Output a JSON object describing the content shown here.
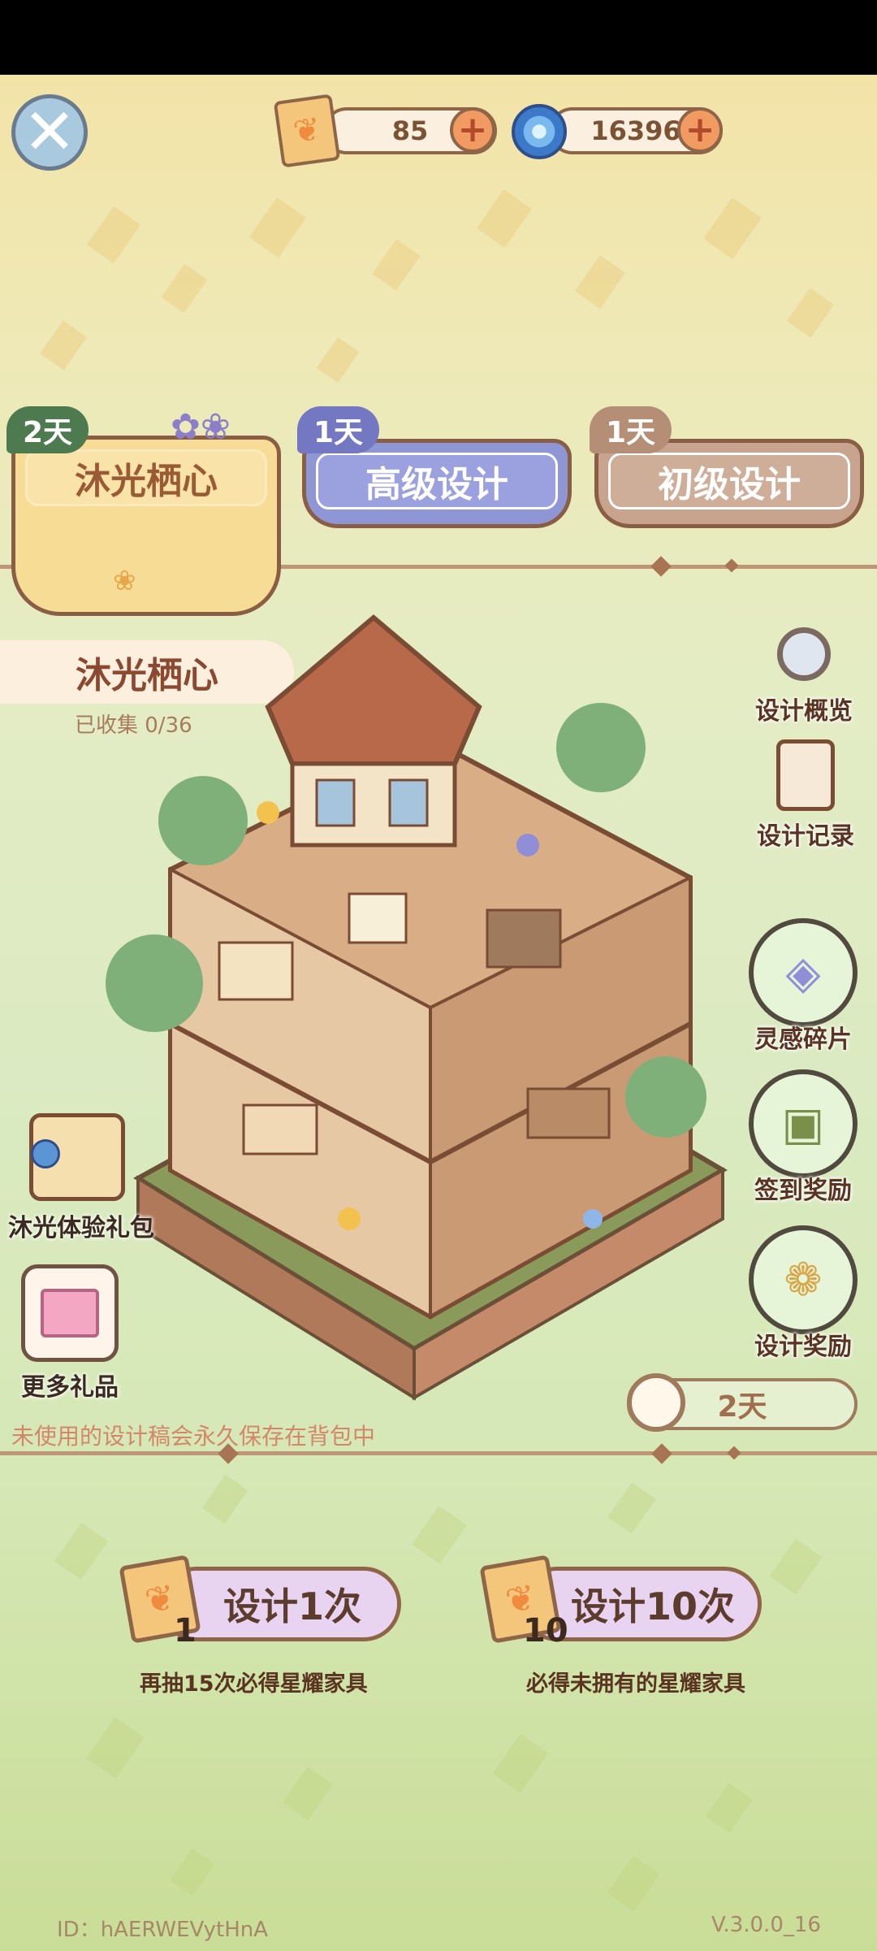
{
  "top_bar": {
    "ticket_count": "85",
    "inspiration_count": "16396"
  },
  "tabs": [
    {
      "label": "沐光栖心",
      "badge": "2天"
    },
    {
      "label": "高级设计",
      "badge": "1天"
    },
    {
      "label": "初级设计",
      "badge": "1天"
    }
  ],
  "house": {
    "name": "沐光栖心",
    "collected": "已收集 0/36"
  },
  "side_menu": {
    "overview": "设计概览",
    "records": "设计记录",
    "fragments": "灵感碎片",
    "checkin": "签到奖励",
    "rewards": "设计奖励"
  },
  "left_menu": {
    "trial_pack": "沐光体验礼包",
    "more_gifts": "更多礼品"
  },
  "timer": "2天",
  "notice": "未使用的设计稿会永久保存在背包中",
  "draw": {
    "single": {
      "count": "1",
      "label": "设计1次",
      "sub": "再抽15次必得星耀家具"
    },
    "ten": {
      "count": "10",
      "label": "设计10次",
      "sub": "必得未拥有的星耀家具"
    }
  },
  "footer": {
    "id": "ID：hAERWEVytHnA",
    "version": "V.3.0.0_16"
  },
  "colors": {
    "tab1": "#f6d98f",
    "tab2": "#8f96d6",
    "tab3": "#c8a38d",
    "accent_brown": "#8f6548"
  }
}
